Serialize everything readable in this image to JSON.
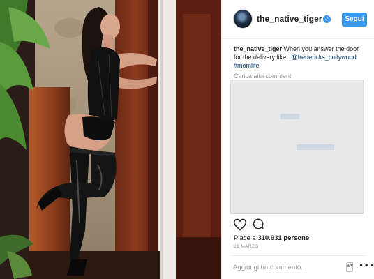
{
  "post": {
    "username": "the_native_tiger",
    "follow_label": "Segui",
    "caption_user": "the_native_tiger",
    "caption_text": "When you answer the door for the delivery like.. ",
    "caption_mention": "@fredericks_hollywood",
    "caption_hashtag": "#momlife",
    "load_more_label": "Carica altri commenti",
    "likes_prefix": "Piace a ",
    "likes_count": "310.931 persone",
    "date": "21 MARZO",
    "comment_placeholder": "Aggiungi un commento...",
    "more_label": "•••",
    "updown_label": "▲▼"
  },
  "icons": {
    "verified": "verified-badge-icon",
    "like": "heart-icon",
    "comment": "speech-bubble-icon"
  },
  "colors": {
    "accent": "#3897f0",
    "text": "#262626",
    "muted": "#999999",
    "link": "#003569"
  }
}
